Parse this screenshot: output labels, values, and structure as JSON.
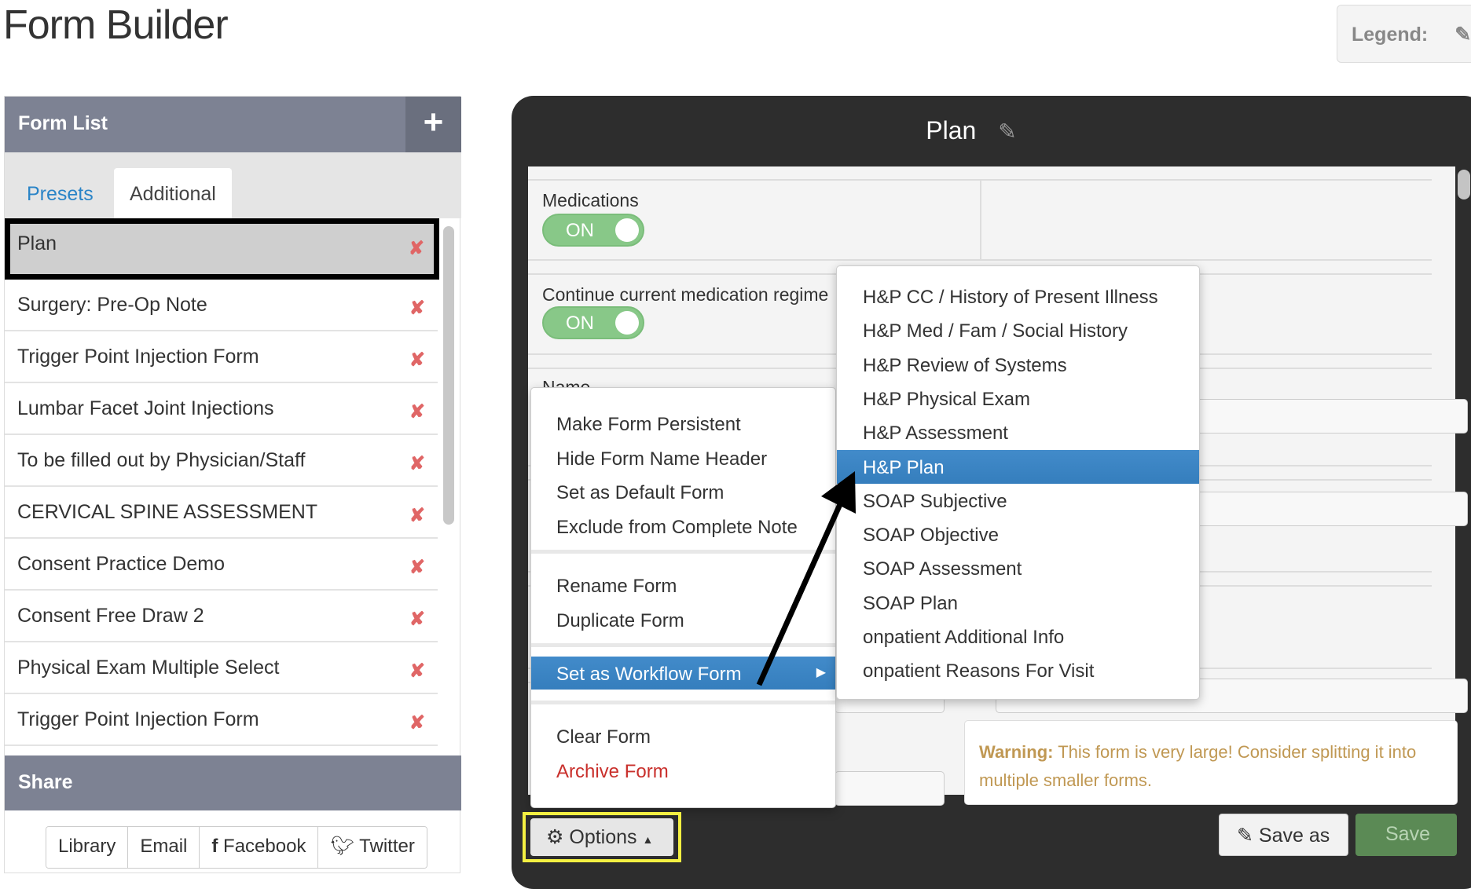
{
  "header": {
    "title": "Form Builder",
    "legend_label": "Legend:",
    "legend_icon": "pencil-icon"
  },
  "form_list": {
    "title": "Form List",
    "add_icon": "plus-icon",
    "tabs": [
      {
        "label": "Presets",
        "active": false
      },
      {
        "label": "Additional",
        "active": true
      }
    ],
    "items": [
      {
        "label": "Plan",
        "selected": true
      },
      {
        "label": "Surgery: Pre-Op Note"
      },
      {
        "label": "Trigger Point Injection Form"
      },
      {
        "label": "Lumbar Facet Joint Injections"
      },
      {
        "label": "To be filled out by Physician/Staff"
      },
      {
        "label": "CERVICAL SPINE ASSESSMENT"
      },
      {
        "label": "Consent Practice Demo"
      },
      {
        "label": "Consent Free Draw 2"
      },
      {
        "label": "Physical Exam Multiple Select"
      },
      {
        "label": "Trigger Point Injection Form"
      }
    ],
    "delete_glyph": "✘"
  },
  "share": {
    "title": "Share",
    "buttons": [
      "Library",
      "Email",
      "Facebook",
      "Twitter"
    ]
  },
  "editor": {
    "title": "Plan",
    "fields": [
      {
        "label": "Medications",
        "toggle": "ON"
      },
      {
        "label": "Continue current medication regime",
        "toggle": "ON"
      },
      {
        "label": "Name"
      }
    ],
    "warning_bold": "Warning:",
    "warning_text": " This form is very large! Consider splitting it into multiple smaller forms."
  },
  "options_menu": {
    "groups": [
      [
        "Make Form Persistent",
        "Hide Form Name Header",
        "Set as Default Form",
        "Exclude from Complete Note"
      ],
      [
        "Rename Form",
        "Duplicate Form"
      ],
      [
        "Set as Workflow Form"
      ],
      [
        "Clear Form",
        "Archive Form"
      ]
    ],
    "danger_color": "#c9302c",
    "highlight_color": "#3a87c8"
  },
  "workflow_submenu": {
    "items": [
      "H&P CC / History of Present Illness",
      "H&P Med / Fam / Social History",
      "H&P Review of Systems",
      "H&P Physical Exam",
      "H&P Assessment",
      "H&P Plan",
      "SOAP Subjective",
      "SOAP Objective",
      "SOAP Assessment",
      "SOAP Plan",
      "onpatient Additional Info",
      "onpatient Reasons For Visit"
    ],
    "highlighted": "H&P Plan"
  },
  "footer": {
    "options_label": "Options",
    "save_as_label": "Save as",
    "save_label": "Save"
  }
}
